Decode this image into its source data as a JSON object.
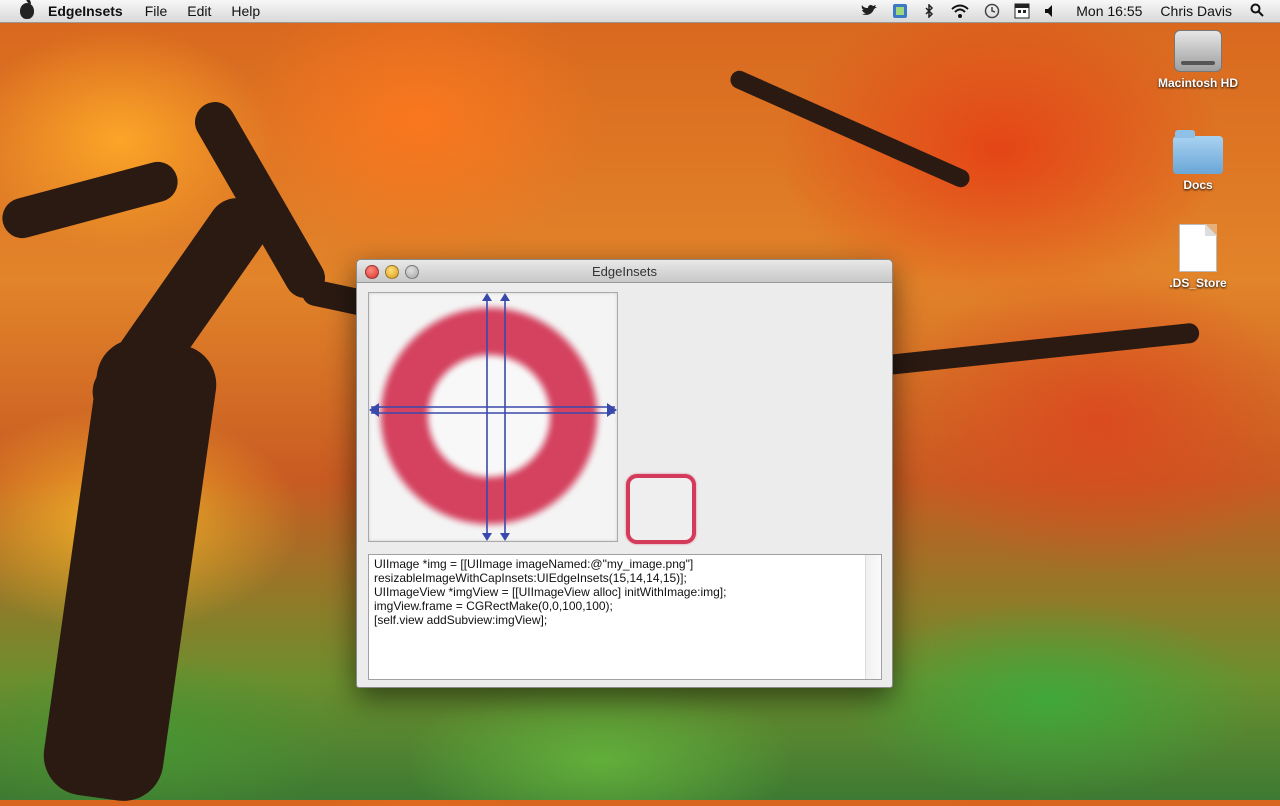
{
  "menubar": {
    "app_name": "EdgeInsets",
    "menus": [
      "File",
      "Edit",
      "Help"
    ],
    "clock": "Mon 16:55",
    "user": "Chris Davis",
    "status_icons": [
      "twitter-icon",
      "dropbox-icon",
      "bluetooth-icon",
      "wifi-icon",
      "time-machine-icon",
      "calendar-icon",
      "volume-icon",
      "spotlight-icon"
    ]
  },
  "desktop": {
    "icons": [
      {
        "label": "Macintosh HD",
        "icon": "hard-drive-icon"
      },
      {
        "label": "Docs",
        "icon": "folder-icon"
      },
      {
        "label": ".DS_Store",
        "icon": "document-icon"
      }
    ]
  },
  "window": {
    "title": "EdgeInsets",
    "code_lines": [
      "UIImage *img = [[UIImage imageNamed:@\"my_image.png\"]",
      "resizableImageWithCapInsets:UIEdgeInsets(15,14,14,15)];",
      "UIImageView *imgView = [[UIImageView alloc] initWithImage:img];",
      "imgView.frame = CGRectMake(0,0,100,100);",
      "[self.view addSubview:imgView];"
    ]
  },
  "colors": {
    "ring": "#d4425f",
    "inset_guides": "#3949ab",
    "preview_border": "#d43a5a"
  }
}
